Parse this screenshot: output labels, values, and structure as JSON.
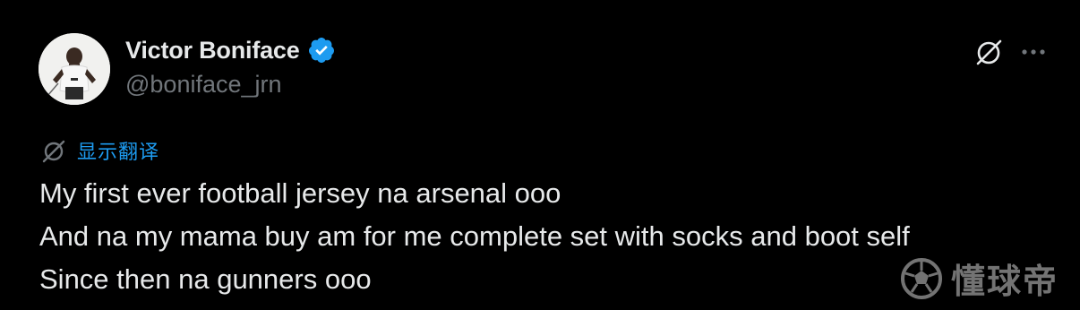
{
  "author": {
    "display_name": "Victor Boniface",
    "handle": "@boniface_jrn",
    "verified": true,
    "verified_color": "#1d9bf0",
    "avatar_icon": "profile-photo"
  },
  "actions": {
    "grok_icon": "grok-icon",
    "more_icon": "more-horizontal-icon"
  },
  "translate": {
    "icon": "translate-icon",
    "label": "显示翻译",
    "color": "#1d9bf0"
  },
  "tweet": {
    "lines": [
      "My first ever football jersey na arsenal ooo",
      "And na my mama buy am for me complete set with socks and boot self",
      "Since then na gunners ooo"
    ]
  },
  "watermark": {
    "logo_icon": "soccer-ball-icon",
    "text": "懂球帝"
  },
  "colors": {
    "background": "#000000",
    "text_primary": "#e7e9ea",
    "text_secondary": "#71767b",
    "accent": "#1d9bf0"
  }
}
